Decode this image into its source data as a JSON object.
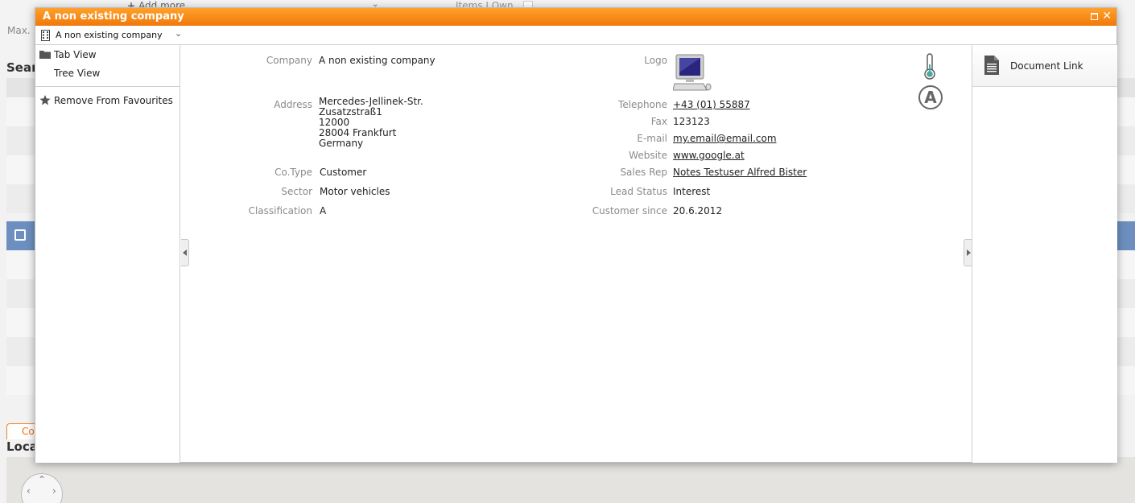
{
  "background": {
    "add_more_label": "Add more",
    "items_i_own_label": "Items I Own",
    "max_label": "Max.",
    "search_heading": "Sear",
    "bottom_tab_label": "Co",
    "location_heading": "Loca"
  },
  "dialog": {
    "title": "A non existing company",
    "breadcrumb_label": "A non existing company",
    "accent_color": "#f58a17"
  },
  "sidebar": {
    "items": [
      {
        "label": "Tab View",
        "icon": "folder-icon"
      },
      {
        "label": "Tree View",
        "icon": ""
      },
      {
        "label": "Remove From Favourites",
        "icon": "star-icon"
      }
    ]
  },
  "details": {
    "company": {
      "label": "Company",
      "value": "A non existing company"
    },
    "address": {
      "label": "Address",
      "lines": [
        "Mercedes-Jellinek-Str.",
        "Zusatzstraß1",
        "12000",
        "28004 Frankfurt",
        "Germany"
      ]
    },
    "cotype": {
      "label": "Co.Type",
      "value": "Customer"
    },
    "sector": {
      "label": "Sector",
      "value": "Motor vehicles"
    },
    "classification": {
      "label": "Classification",
      "value": "A"
    },
    "logo": {
      "label": "Logo",
      "icon": "computer-logo-icon"
    },
    "telephone": {
      "label": "Telephone",
      "value": "+43 (01) 55887"
    },
    "fax": {
      "label": "Fax",
      "value": "123123"
    },
    "email": {
      "label": "E-mail",
      "value": "my.email@email.com"
    },
    "website": {
      "label": "Website",
      "value": "www.google.at"
    },
    "sales_rep": {
      "label": "Sales Rep",
      "value": "Notes Testuser Alfred Bister"
    },
    "lead_status": {
      "label": "Lead Status",
      "value": "Interest"
    },
    "customer_since": {
      "label": "Customer since",
      "value": "20.6.2012"
    },
    "indicators": {
      "thermometer_icon": "thermometer-icon",
      "class_badge": "A"
    }
  },
  "right_panel": {
    "document_link_label": "Document Link"
  }
}
